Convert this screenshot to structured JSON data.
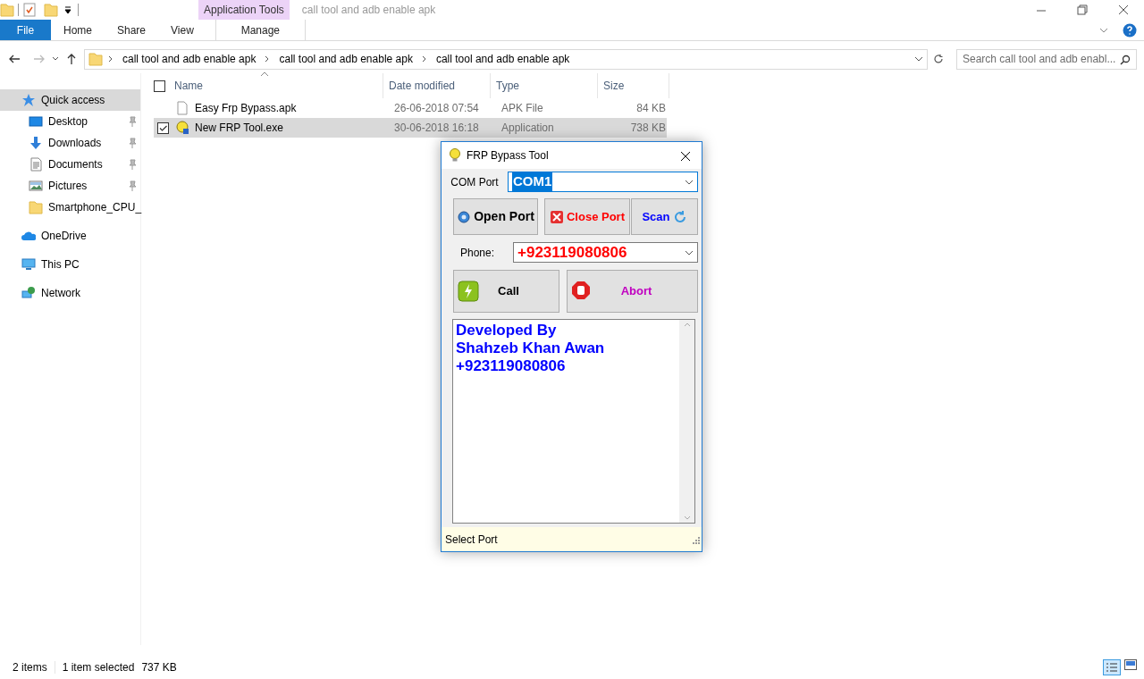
{
  "window": {
    "title": "call tool and adb enable apk",
    "context_group": "Application Tools"
  },
  "ribbon_tabs": [
    {
      "label": "File",
      "kind": "file",
      "selected": false
    },
    {
      "label": "Home",
      "kind": "tab",
      "selected": false
    },
    {
      "label": "Share",
      "kind": "tab",
      "selected": false
    },
    {
      "label": "View",
      "kind": "tab",
      "selected": false
    },
    {
      "label": "Manage",
      "kind": "context",
      "selected": false
    }
  ],
  "address_bar": {
    "breadcrumbs": [
      "call tool and adb enable apk",
      "call tool and adb enable apk",
      "call tool and adb enable apk"
    ]
  },
  "search": {
    "placeholder": "Search call tool and adb enabl..."
  },
  "sidebar": {
    "items": [
      {
        "label": "Quick access",
        "kind": "quick",
        "selected": true,
        "children": [
          {
            "label": "Desktop",
            "kind": "desktop",
            "pinned": true,
            "selected": false
          },
          {
            "label": "Downloads",
            "kind": "downloads",
            "pinned": true,
            "selected": false
          },
          {
            "label": "Documents",
            "kind": "documents",
            "pinned": true,
            "selected": false
          },
          {
            "label": "Pictures",
            "kind": "pictures",
            "pinned": true,
            "selected": false
          },
          {
            "label": "Smartphone_CPU_",
            "kind": "folder",
            "pinned": false,
            "selected": false
          }
        ]
      },
      {
        "label": "OneDrive",
        "kind": "cloud",
        "selected": false
      },
      {
        "label": "This PC",
        "kind": "pc",
        "selected": false
      },
      {
        "label": "Network",
        "kind": "network",
        "selected": false
      }
    ]
  },
  "file_list": {
    "select_all": {
      "checked": false
    },
    "columns": [
      {
        "label": "Name",
        "sorted": true
      },
      {
        "label": "Date modified",
        "sorted": false
      },
      {
        "label": "Type",
        "sorted": false
      },
      {
        "label": "Size",
        "sorted": false
      }
    ],
    "rows": [
      {
        "name": "Easy Frp Bypass.apk",
        "date": "26-06-2018 07:54",
        "type": "APK File",
        "size": "84 KB",
        "kind": "file",
        "selected": false
      },
      {
        "name": "New FRP Tool.exe",
        "date": "30-06-2018 16:18",
        "type": "Application",
        "size": "738 KB",
        "kind": "exe",
        "selected": true
      }
    ]
  },
  "status_bar": {
    "item_count": "2 items",
    "selection": "1 item selected",
    "selection_size": "737 KB"
  },
  "dialog": {
    "title": "FRP Bypass Tool",
    "com_port": {
      "label": "COM Port",
      "value": "COM1"
    },
    "port_buttons": [
      {
        "label": "Open Port",
        "kind": "open"
      },
      {
        "label": "Close Port",
        "kind": "close"
      },
      {
        "label": "Scan",
        "kind": "scan"
      }
    ],
    "phone": {
      "label": "Phone:",
      "value": "+923119080806"
    },
    "actions": [
      {
        "label": "Call",
        "kind": "call"
      },
      {
        "label": "Abort",
        "kind": "abort"
      }
    ],
    "log": [
      "Developed By",
      "Shahzeb Khan Awan",
      "+923119080806"
    ],
    "status": "Select Port"
  }
}
